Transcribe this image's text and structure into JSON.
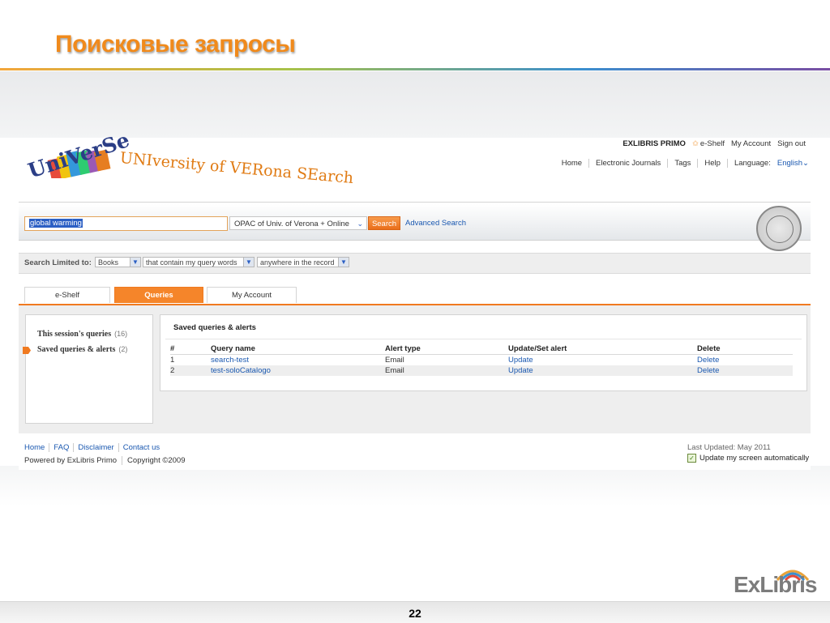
{
  "slide": {
    "title": "Поисковые запросы",
    "page_number": "22",
    "brand": "ExLibris"
  },
  "topbar": {
    "product": "EXLIBRIS PRIMO",
    "eshelf": "e-Shelf",
    "my_account": "My Account",
    "sign_out": "Sign out"
  },
  "logo": {
    "main": "UNIversity of VERona SEarch",
    "short": "UniVerSe"
  },
  "nav": {
    "items": [
      "Home",
      "Electronic Journals",
      "Tags",
      "Help"
    ],
    "language_label": "Language:",
    "language_value": "English"
  },
  "search": {
    "query": "global warming",
    "scope": "OPAC of Univ. of Verona + Online",
    "button": "Search",
    "advanced": "Advanced Search"
  },
  "limits": {
    "label": "Search Limited to:",
    "type": "Books",
    "match": "that contain my query words",
    "field": "anywhere in the record"
  },
  "tabs": [
    "e-Shelf",
    "Queries",
    "My Account"
  ],
  "left_panel": {
    "items": [
      {
        "label": "This session's queries",
        "count": "(16)"
      },
      {
        "label": "Saved queries & alerts",
        "count": "(2)"
      }
    ]
  },
  "saved": {
    "title": "Saved queries & alerts",
    "columns": [
      "#",
      "Query name",
      "Alert type",
      "Update/Set alert",
      "Delete"
    ],
    "rows": [
      {
        "num": "1",
        "name": "search-test",
        "alert": "Email",
        "update": "Update",
        "delete": "Delete"
      },
      {
        "num": "2",
        "name": "test-soloCatalogo",
        "alert": "Email",
        "update": "Update",
        "delete": "Delete"
      }
    ]
  },
  "footer": {
    "links": [
      "Home",
      "FAQ",
      "Disclaimer",
      "Contact us"
    ],
    "powered": "Powered by ExLibris Primo",
    "copyright": "Copyright ©2009",
    "last_updated": "Last Updated: May 2011",
    "auto_update": "Update my screen automatically"
  }
}
